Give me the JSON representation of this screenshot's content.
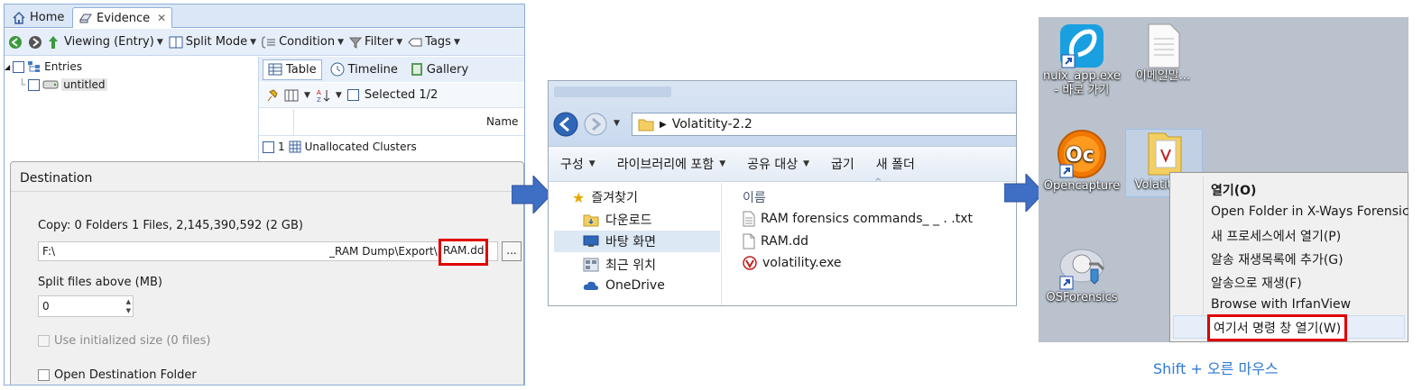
{
  "nuix": {
    "tabs": [
      {
        "label": "Home"
      },
      {
        "label": "Evidence"
      }
    ],
    "tab_close": "✕",
    "toolbar": {
      "viewing": "Viewing (Entry)",
      "split_mode": "Split Mode",
      "condition": "Condition",
      "filter": "Filter",
      "tags": "Tags"
    },
    "tree": {
      "root": "Entries",
      "child": "untitled"
    },
    "view_tabs": [
      "Table",
      "Timeline",
      "Gallery"
    ],
    "selected": "Selected 1/2",
    "column_header": "Name",
    "rows": [
      {
        "index": "1",
        "name": "Unallocated Clusters"
      }
    ],
    "destination": {
      "title": "Destination",
      "copy_summary": "Copy: 0 Folders 1 Files, 2,145,390,592 (2 GB)",
      "path_drive": "F:\\",
      "path_mid": "_RAM Dump\\Export\\",
      "path_file": "RAM.dd",
      "browse_label": "...",
      "split_label": "Split files above (MB)",
      "split_value": "0",
      "use_initialized": "Use initialized size (0 files)",
      "open_destination": "Open Destination Folder"
    }
  },
  "explorer": {
    "breadcrumb": "Volatitity-2.2",
    "commands": [
      "구성",
      "라이브러리에 포함",
      "공유 대상",
      "굽기",
      "새 폴더"
    ],
    "nav": [
      "즐겨찾기",
      "다운로드",
      "바탕 화면",
      "최근 위치",
      "OneDrive"
    ],
    "column": "이름",
    "files": [
      {
        "name": "RAM forensics commands_ _ . .txt",
        "icon": "text-file-icon"
      },
      {
        "name": "RAM.dd",
        "icon": "file-icon"
      },
      {
        "name": "volatility.exe",
        "icon": "volatility-icon"
      }
    ]
  },
  "desktop": {
    "icons": [
      {
        "line1": "nuix_app.exe",
        "line2": "- 바로 가기"
      },
      {
        "line1": "이메일말...",
        "line2": ""
      },
      {
        "line1": "Opencapture",
        "line2": ""
      },
      {
        "line1": "Volatiti",
        "line2": ""
      },
      {
        "line1": "OSForensics",
        "line2": ""
      }
    ],
    "context_menu": [
      {
        "label": "열기(O)"
      },
      {
        "label": "Open Folder in X-Ways Forensics"
      },
      {
        "label": "새 프로세스에서 열기(P)"
      },
      {
        "label": "알송 재생목록에 추가(G)"
      },
      {
        "label": "알송으로 재생(F)"
      },
      {
        "label": "Browse with IrfanView"
      },
      {
        "label": "여기서 명령 창 열기(W)"
      }
    ]
  },
  "caption": "Shift + 오른 마우스",
  "colors": {
    "highlight_red": "#e00000",
    "arrow_blue": "#3f6fc4",
    "caption_blue": "#2f7ad3"
  }
}
